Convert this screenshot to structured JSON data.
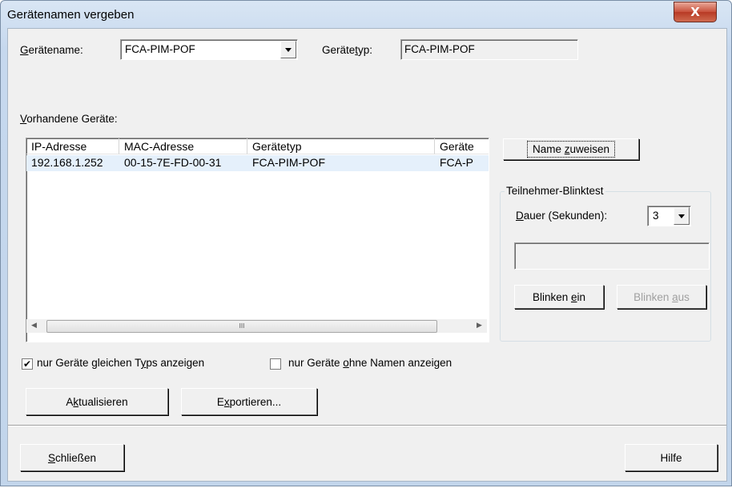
{
  "window": {
    "title": "Gerätenamen vergeben",
    "close_symbol": "X"
  },
  "device_name": {
    "label_pre": "",
    "label_ul": "G",
    "label_post": "erätename:",
    "value": "FCA-PIM-POF"
  },
  "device_type": {
    "label_pre": "Geräte",
    "label_ul": "t",
    "label_post": "yp:",
    "value": "FCA-PIM-POF"
  },
  "existing": {
    "label_ul": "V",
    "label_post": "orhandene Geräte:"
  },
  "table": {
    "columns": [
      "IP-Adresse",
      "MAC-Adresse",
      "Gerätetyp",
      "Geräte"
    ],
    "rows": [
      [
        "192.168.1.252",
        "00-15-7E-FD-00-31",
        "FCA-PIM-POF",
        "FCA-P"
      ]
    ],
    "hscroll_grip": "III",
    "left_arrow": "◀",
    "right_arrow": "▶"
  },
  "assign": {
    "pre": "Name ",
    "ul": "z",
    "post": "uweisen"
  },
  "blink_group": {
    "title": "Teilnehmer-Blinktest",
    "duration_ul": "D",
    "duration_post": "auer (Sekunden):",
    "duration_value": "3",
    "blink_on_pre": "Blinken ",
    "blink_on_ul": "e",
    "blink_on_post": "in",
    "blink_off_pre": "Blinken ",
    "blink_off_ul": "a",
    "blink_off_post": "us"
  },
  "filters": {
    "same_type_checked": true,
    "same_type_pre": "nur Geräte gleichen T",
    "same_type_ul": "y",
    "same_type_post": "ps anzeigen",
    "no_name_checked": false,
    "no_name_pre": "nur Geräte ",
    "no_name_ul": "o",
    "no_name_post": "hne Namen anzeigen",
    "check_mark": "✔"
  },
  "buttons": {
    "refresh_pre": "A",
    "refresh_ul": "k",
    "refresh_post": "tualisieren",
    "export_pre": "E",
    "export_ul": "x",
    "export_post": "portieren...",
    "close_ul": "S",
    "close_post": "chließen",
    "help": "Hilfe"
  },
  "icons": [
    "close-icon",
    "dropdown-arrow-icon",
    "checkbox-check-icon",
    "scroll-left-icon",
    "scroll-right-icon"
  ]
}
